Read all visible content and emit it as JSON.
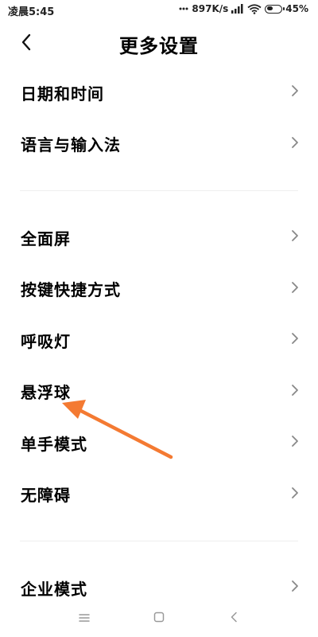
{
  "status_bar": {
    "time": "凌晨5:45",
    "network_speed": "897K/s",
    "battery_percent": "45%",
    "battery_level": 0.45
  },
  "header": {
    "title": "更多设置",
    "back_icon": "back-arrow-icon"
  },
  "sections": [
    {
      "items": [
        {
          "label": "日期和时间"
        },
        {
          "label": "语言与输入法"
        }
      ]
    },
    {
      "items": [
        {
          "label": "全面屏"
        },
        {
          "label": "按键快捷方式"
        },
        {
          "label": "呼吸灯"
        },
        {
          "label": "悬浮球"
        },
        {
          "label": "单手模式"
        },
        {
          "label": "无障碍"
        }
      ]
    },
    {
      "items": [
        {
          "label": "企业模式"
        }
      ]
    }
  ],
  "annotation": {
    "color": "#f47a32",
    "target": "悬浮球"
  },
  "nav_bar": {
    "icons": [
      "menu-icon",
      "home-icon",
      "back-icon"
    ]
  }
}
